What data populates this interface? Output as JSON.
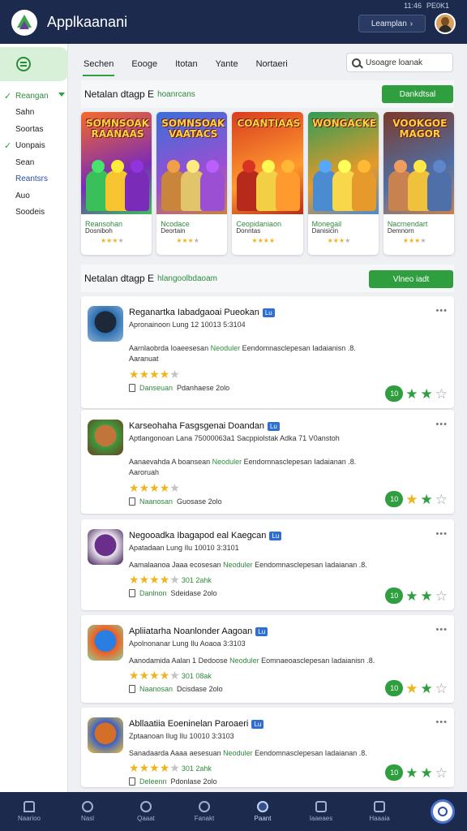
{
  "header": {
    "title": "Applkaanani",
    "status": [
      "11:46",
      "PE0K1"
    ],
    "account_label": "Leamplan",
    "account_chevron": "chevron-down-icon"
  },
  "sidebar": {
    "items": [
      {
        "label": "Reangan",
        "checked": true,
        "active": true
      },
      {
        "label": "Sahn",
        "checked": false
      },
      {
        "label": "Soortas",
        "checked": false
      },
      {
        "label": "Uonpais",
        "checked": true
      },
      {
        "label": "Sean",
        "checked": false
      },
      {
        "label": "Reantsrs",
        "checked": false,
        "blue": true
      },
      {
        "label": "Auo",
        "checked": false
      },
      {
        "label": "Soodeis",
        "checked": false
      }
    ]
  },
  "tabs": [
    "Sechen",
    "Eooge",
    "Itotan",
    "Yante",
    "Nortaeri"
  ],
  "search": {
    "value": "Usoagre loanak"
  },
  "featured": {
    "title": "Netalan dtagp E",
    "subtitle": "hoanrcans",
    "button": "Dankdtsal",
    "games": [
      {
        "art_title": "SOMNSOAK RAANAAS",
        "name": "Reansohan",
        "sub": "Dosniboh",
        "stars": 3,
        "colors": [
          "#f56a2a",
          "#7a2bb8",
          "#3ac05a",
          "#f7c530"
        ]
      },
      {
        "art_title": "SOMNSOAK VAATACS",
        "name": "Ncodace",
        "sub": "Deortain",
        "stars": 3,
        "colors": [
          "#3a6fd8",
          "#9b4fd2",
          "#c9853b",
          "#e2c46a"
        ]
      },
      {
        "art_title": "COANTIAAS",
        "name": "Ceopidaniaon",
        "sub": "Donntas",
        "stars": 4,
        "colors": [
          "#d83c1f",
          "#ff9a2e",
          "#b62a1c",
          "#f2cf45"
        ]
      },
      {
        "art_title": "WONGACKE",
        "name": "Monegail",
        "sub": "Danisicin",
        "stars": 3,
        "colors": [
          "#2f9c56",
          "#e59a2b",
          "#4a8bd1",
          "#f8d84a"
        ]
      },
      {
        "art_title": "VOOKGOE MAGOR",
        "name": "Nacrnendart",
        "sub": "Demnorn",
        "stars": 3,
        "colors": [
          "#7b3b2a",
          "#4f6fa8",
          "#c8824f",
          "#f0c13a"
        ]
      }
    ]
  },
  "list_section": {
    "title": "Netalan dtagp E",
    "subtitle": "hlangoolbdaoam",
    "button": "Vlneo iadt"
  },
  "apps": [
    {
      "name": "Reganartka Iabadgaoai Pueokan",
      "badge": "Lu",
      "meta": "Apronainoon  Lung 12 10013  5:3104",
      "desc_a": "Aarnlaobrda Ioaeesesan",
      "desc_hl": "Neoduler",
      "desc_b": "Eendomnasclepesan Iadaianisn .8.",
      "desc_c": "Aaranuat",
      "rating": 4,
      "rating_text": "",
      "dev_name": "Danseuan",
      "dev_rest": "Pdanhaese 2olo",
      "pill": "10",
      "stars": [
        "g",
        "g",
        "o"
      ],
      "icon_colors": [
        "#2c6fb0",
        "#1d2838",
        "#8db3d8"
      ]
    },
    {
      "name": "Karseohaha Fasgsgenai Doandan",
      "badge": "Lu",
      "meta": "Aptlangonoan  Lana 75000063a1  Sacppiolstak Adka 71 V0anstoh",
      "desc_a": "Aanaevahda A boansean",
      "desc_hl": "Neoduler",
      "desc_b": "Eendomnasclepesan Iadaianan .8.",
      "desc_c": "Aaroruah",
      "rating": 4,
      "rating_text": "",
      "dev_name": "Naanosan",
      "dev_rest": "Guosase 2olo",
      "pill": "10",
      "stars": [
        "y",
        "g",
        "o"
      ],
      "icon_colors": [
        "#3c9a3e",
        "#c2753a",
        "#6b3f1c"
      ]
    },
    {
      "name": "Negooadka Ibagapod eal Kaegcan",
      "badge": "Lu",
      "meta": "Apatadaan  Lung Ilu 10010  3:3101",
      "desc_a": "Aamalaanoa Jaaa ecosesan",
      "desc_hl": "Neoduler",
      "desc_b": "Eendomnasclepesan Iadaianan .8.",
      "desc_c": "",
      "rating": 4,
      "rating_text": "301 2ahk",
      "dev_name": "Danlnon",
      "dev_rest": "Sdeidase 2olo",
      "pill": "10",
      "stars": [
        "g",
        "g",
        "o"
      ],
      "icon_colors": [
        "#ece6f0",
        "#6a2f8a",
        "#3a1550"
      ]
    },
    {
      "name": "Apliiatarha Noanlonder Aagoan",
      "badge": "Lu",
      "meta": "Apolnonanar  Lung Ilu Aoaoa 3:3103",
      "desc_a": "Aanodamida Aalan 1 Dedoose",
      "desc_hl": "Neoduler",
      "desc_b": "Eomnaeoasclepesan Iadaianisn .8.",
      "desc_c": "",
      "rating": 4,
      "rating_text": "301 08ak",
      "dev_name": "Naanosan",
      "dev_rest": "Dcisdase 2olo",
      "pill": "10",
      "stars": [
        "y",
        "g",
        "o"
      ],
      "icon_colors": [
        "#f25c1e",
        "#2a7de1",
        "#8ed19a"
      ]
    },
    {
      "name": "Abllaatiia Eoeninelan Paroaeri",
      "badge": "Lu",
      "meta": "Zptaanoan  Ilug Ilu 10010  3:3103",
      "desc_a": "Sanadaarda Aaaa aesesuan",
      "desc_hl": "Neoduler",
      "desc_b": "Eendomnasclepesan Iadaianan .8.",
      "desc_c": "",
      "rating": 4,
      "rating_text": "301 2ahk",
      "dev_name": "Deleenn",
      "dev_rest": "Pdonlase 2olo",
      "pill": "10",
      "stars": [
        "g",
        "g",
        "o"
      ],
      "icon_colors": [
        "#3a5fc4",
        "#d46f2a",
        "#f2c33a"
      ]
    }
  ],
  "bottom_nav": [
    {
      "label": "Naarioo",
      "icon": "home-icon"
    },
    {
      "label": "Nasl",
      "icon": "info-icon"
    },
    {
      "label": "Qaaat",
      "icon": "chat-icon"
    },
    {
      "label": "Fanakt",
      "icon": "bookmark-icon"
    },
    {
      "label": "Paant",
      "icon": "compass-icon",
      "active": true
    },
    {
      "label": "Iaaeaes",
      "icon": "screen-icon"
    },
    {
      "label": "Haaaia",
      "icon": "bag-icon"
    }
  ],
  "fab_icon": "search-icon"
}
